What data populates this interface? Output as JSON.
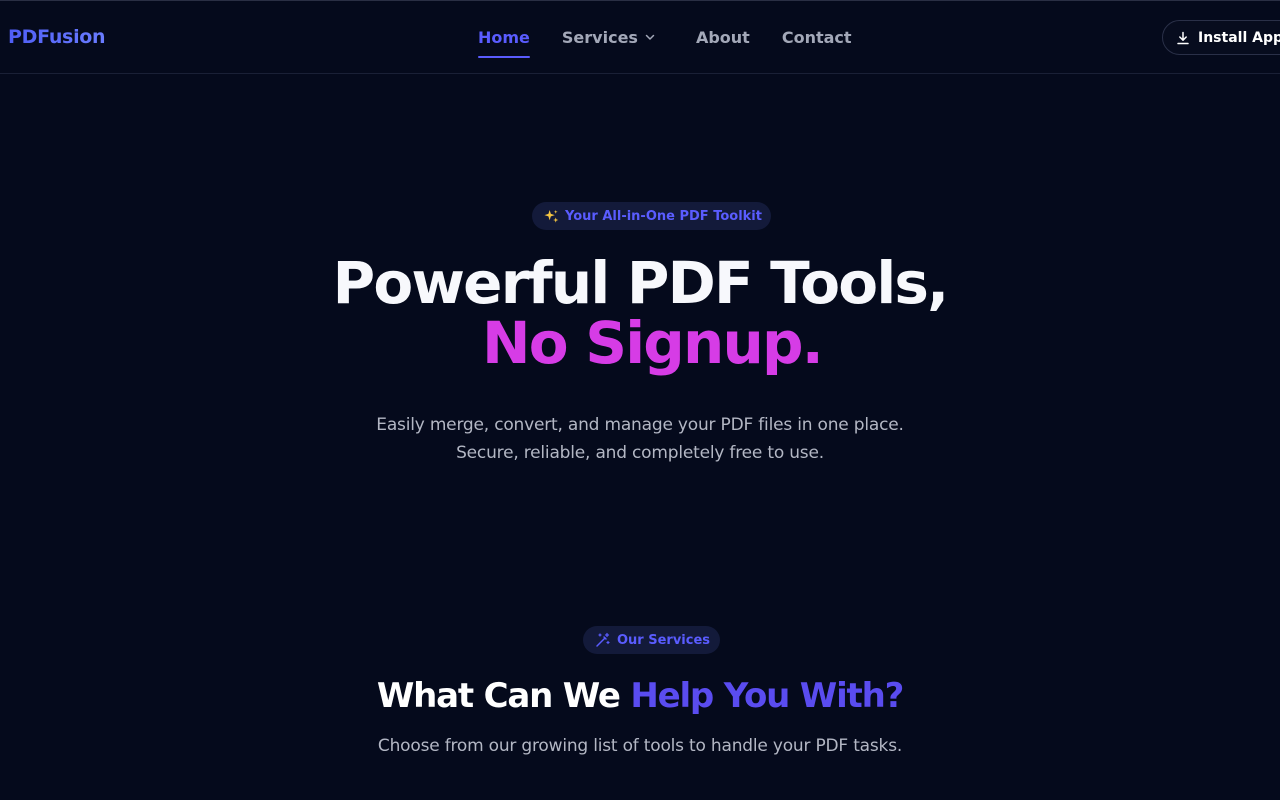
{
  "header": {
    "logo": "PDFusion",
    "nav": [
      {
        "label": "Home",
        "active": true
      },
      {
        "label": "Services",
        "has_dropdown": true
      },
      {
        "label": "About"
      },
      {
        "label": "Contact"
      }
    ],
    "install_button": "Install App"
  },
  "hero": {
    "badge_icon": "sparkles-icon",
    "badge": "Your All-in-One PDF Toolkit",
    "title_line1": "Powerful PDF Tools,",
    "title_line2": "No Signup.",
    "subtitle_line1": "Easily merge, convert, and manage your PDF files in one place.",
    "subtitle_line2": "Secure, reliable, and completely free to use."
  },
  "services": {
    "badge_icon": "magic-wand-icon",
    "badge": "Our Services",
    "title_part1": "What Can We",
    "title_part2": "Help You With?",
    "subtitle": "Choose from our growing list of tools to handle your PDF tasks."
  },
  "colors": {
    "background": "#050a1c",
    "accent": "#5a5cff",
    "magenta": "#d63ce6"
  }
}
